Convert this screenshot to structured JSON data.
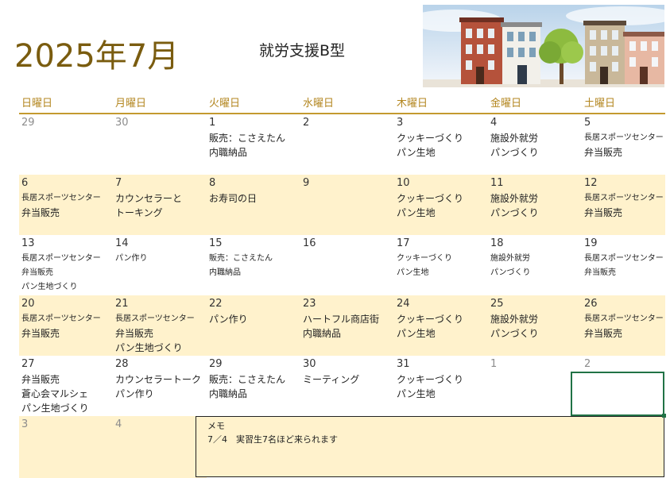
{
  "header": {
    "title": "2025年7月",
    "subtitle": "就労支援B型"
  },
  "weekdays": [
    "日曜日",
    "月曜日",
    "火曜日",
    "水曜日",
    "木曜日",
    "金曜日",
    "土曜日"
  ],
  "weeks": [
    {
      "shaded": false,
      "days": [
        {
          "date": "29",
          "other": true,
          "lines": []
        },
        {
          "date": "30",
          "other": true,
          "lines": []
        },
        {
          "date": "1",
          "other": false,
          "lines": [
            {
              "text": "販売：こさえたん",
              "small": false
            },
            {
              "text": "内職納品",
              "small": false
            }
          ]
        },
        {
          "date": "2",
          "other": false,
          "lines": []
        },
        {
          "date": "3",
          "other": false,
          "lines": [
            {
              "text": "クッキーづくり",
              "small": false
            },
            {
              "text": "パン生地",
              "small": false
            }
          ]
        },
        {
          "date": "4",
          "other": false,
          "lines": [
            {
              "text": "施設外就労",
              "small": false
            },
            {
              "text": "パンづくり",
              "small": false
            }
          ]
        },
        {
          "date": "5",
          "other": false,
          "lines": [
            {
              "text": "長居スポーツセンター",
              "small": true
            },
            {
              "text": "弁当販売",
              "small": false
            }
          ]
        }
      ]
    },
    {
      "shaded": true,
      "days": [
        {
          "date": "6",
          "other": false,
          "lines": [
            {
              "text": "長居スポーツセンター",
              "small": true
            },
            {
              "text": "弁当販売",
              "small": false
            }
          ]
        },
        {
          "date": "7",
          "other": false,
          "lines": [
            {
              "text": "カウンセラーと",
              "small": false
            },
            {
              "text": "トーキング",
              "small": false
            }
          ]
        },
        {
          "date": "8",
          "other": false,
          "lines": [
            {
              "text": "お寿司の日",
              "small": false
            }
          ]
        },
        {
          "date": "9",
          "other": false,
          "lines": []
        },
        {
          "date": "10",
          "other": false,
          "lines": [
            {
              "text": "クッキーづくり",
              "small": false
            },
            {
              "text": "パン生地",
              "small": false
            }
          ]
        },
        {
          "date": "11",
          "other": false,
          "lines": [
            {
              "text": "施設外就労",
              "small": false
            },
            {
              "text": "パンづくり",
              "small": false
            }
          ]
        },
        {
          "date": "12",
          "other": false,
          "lines": [
            {
              "text": "長居スポーツセンター",
              "small": true
            },
            {
              "text": "弁当販売",
              "small": false
            }
          ]
        }
      ]
    },
    {
      "shaded": false,
      "days": [
        {
          "date": "13",
          "other": false,
          "lines": [
            {
              "text": "長居スポーツセンター",
              "small": true
            },
            {
              "text": "弁当販売",
              "small": true
            },
            {
              "text": "パン生地づくり",
              "small": true
            }
          ]
        },
        {
          "date": "14",
          "other": false,
          "lines": [
            {
              "text": "パン作り",
              "small": true
            }
          ]
        },
        {
          "date": "15",
          "other": false,
          "lines": [
            {
              "text": "販売：こさえたん",
              "small": true
            },
            {
              "text": "内職納品",
              "small": true
            }
          ]
        },
        {
          "date": "16",
          "other": false,
          "lines": []
        },
        {
          "date": "17",
          "other": false,
          "lines": [
            {
              "text": "クッキーづくり",
              "small": true
            },
            {
              "text": "パン生地",
              "small": true
            }
          ]
        },
        {
          "date": "18",
          "other": false,
          "lines": [
            {
              "text": "施設外就労",
              "small": true
            },
            {
              "text": "パンづくり",
              "small": true
            }
          ]
        },
        {
          "date": "19",
          "other": false,
          "lines": [
            {
              "text": "長居スポーツセンター",
              "small": true
            },
            {
              "text": "弁当販売",
              "small": true
            }
          ]
        }
      ]
    },
    {
      "shaded": true,
      "days": [
        {
          "date": "20",
          "other": false,
          "lines": [
            {
              "text": "長居スポーツセンター",
              "small": true
            },
            {
              "text": "弁当販売",
              "small": false
            }
          ]
        },
        {
          "date": "21",
          "other": false,
          "lines": [
            {
              "text": "長居スポーツセンター",
              "small": true
            },
            {
              "text": "弁当販売",
              "small": false
            },
            {
              "text": "パン生地づくり",
              "small": false
            }
          ]
        },
        {
          "date": "22",
          "other": false,
          "lines": [
            {
              "text": "パン作り",
              "small": false
            }
          ]
        },
        {
          "date": "23",
          "other": false,
          "lines": [
            {
              "text": "ハートフル商店街",
              "small": false
            },
            {
              "text": "内職納品",
              "small": false
            }
          ]
        },
        {
          "date": "24",
          "other": false,
          "lines": [
            {
              "text": "クッキーづくり",
              "small": false
            },
            {
              "text": "パン生地",
              "small": false
            }
          ]
        },
        {
          "date": "25",
          "other": false,
          "lines": [
            {
              "text": "施設外就労",
              "small": false
            },
            {
              "text": "パンづくり",
              "small": false
            }
          ]
        },
        {
          "date": "26",
          "other": false,
          "lines": [
            {
              "text": "長居スポーツセンター",
              "small": true
            },
            {
              "text": "弁当販売",
              "small": false
            }
          ]
        }
      ]
    },
    {
      "shaded": false,
      "days": [
        {
          "date": "27",
          "other": false,
          "lines": [
            {
              "text": "弁当販売",
              "small": false
            },
            {
              "text": "蒼心会マルシェ",
              "small": false
            },
            {
              "text": "パン生地づくり",
              "small": false
            }
          ]
        },
        {
          "date": "28",
          "other": false,
          "lines": [
            {
              "text": "カウンセラートーク",
              "small": false
            },
            {
              "text": "パン作り",
              "small": false
            }
          ]
        },
        {
          "date": "29",
          "other": false,
          "lines": [
            {
              "text": "販売：こさえたん",
              "small": false
            },
            {
              "text": "内職納品",
              "small": false
            }
          ]
        },
        {
          "date": "30",
          "other": false,
          "lines": [
            {
              "text": "ミーティング",
              "small": false
            }
          ]
        },
        {
          "date": "31",
          "other": false,
          "lines": [
            {
              "text": "クッキーづくり",
              "small": false
            },
            {
              "text": "パン生地",
              "small": false
            }
          ]
        },
        {
          "date": "1",
          "other": true,
          "lines": []
        },
        {
          "date": "2",
          "other": true,
          "lines": []
        }
      ]
    },
    {
      "shaded": true,
      "days": [
        {
          "date": "3",
          "other": true,
          "lines": []
        },
        {
          "date": "4",
          "other": true,
          "lines": []
        }
      ]
    }
  ],
  "memo": {
    "title": "メモ",
    "text": "7／4　実習生7名ほど来られます"
  },
  "colors": {
    "title": "#7a5c0f",
    "weekday_header": "#b3861f",
    "rule": "#c49a2f",
    "shade": "#fff2cc",
    "selection": "#217346"
  }
}
